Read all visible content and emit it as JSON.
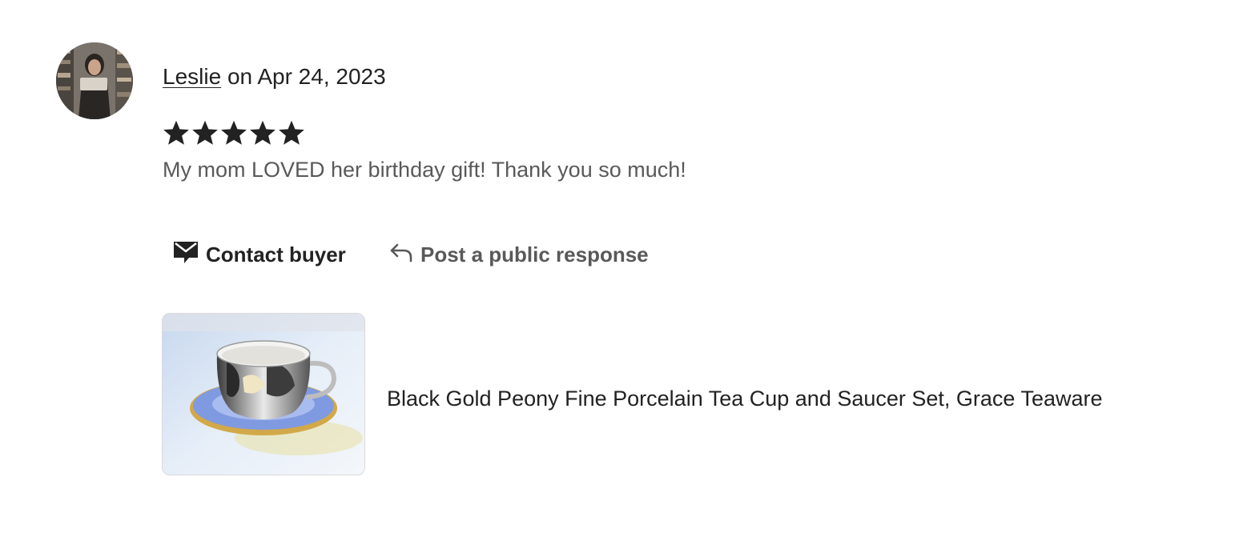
{
  "review": {
    "reviewer_name": "Leslie",
    "date_text": " on Apr 24, 2023",
    "rating": 5,
    "rating_max": 5,
    "text": "My mom LOVED her birthday gift! Thank you so much!"
  },
  "actions": {
    "contact_label": "Contact buyer",
    "respond_label": "Post a public response"
  },
  "listing": {
    "title": "Black Gold Peony Fine Porcelain Tea Cup and Saucer Set, Grace Teaware"
  },
  "colors": {
    "text_primary": "#222222",
    "text_secondary": "#595959",
    "star": "#222222",
    "thumb_border": "#d9d9d9"
  },
  "icons": {
    "contact": "envelope-icon",
    "respond": "reply-arrow-icon",
    "rating": "star-icon"
  }
}
